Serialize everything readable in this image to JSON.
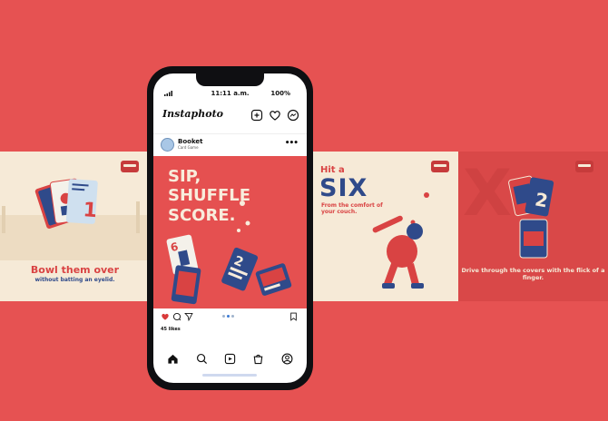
{
  "colors": {
    "background": "#e65252",
    "cream": "#f6ead7",
    "brand_red": "#d94343",
    "brand_blue": "#2f4a8a"
  },
  "panel_left": {
    "title": "Bowl them over",
    "subtitle": "without batting an eyelid."
  },
  "panel_six": {
    "kicker": "Hit a",
    "headline": "SIX",
    "subtitle": "From the comfort of your couch."
  },
  "panel_right": {
    "subtitle": "Drive through the covers with the flick of a finger."
  },
  "phone": {
    "status": {
      "time": "11:11 a.m.",
      "battery": "100%"
    },
    "app": {
      "title": "Instaphoto",
      "icons": [
        "add-post-icon",
        "heart-icon",
        "messenger-icon"
      ]
    },
    "post": {
      "account_name": "Booket",
      "account_subtitle": "Card Game",
      "headline_lines": [
        "SIP,",
        "SHUFFLE",
        "SCORE."
      ],
      "likes": "45 likes",
      "carousel_dots": 3,
      "active_dot": 1
    },
    "nav_icons": [
      "home-icon",
      "search-icon",
      "reels-icon",
      "shop-icon",
      "profile-icon"
    ]
  }
}
